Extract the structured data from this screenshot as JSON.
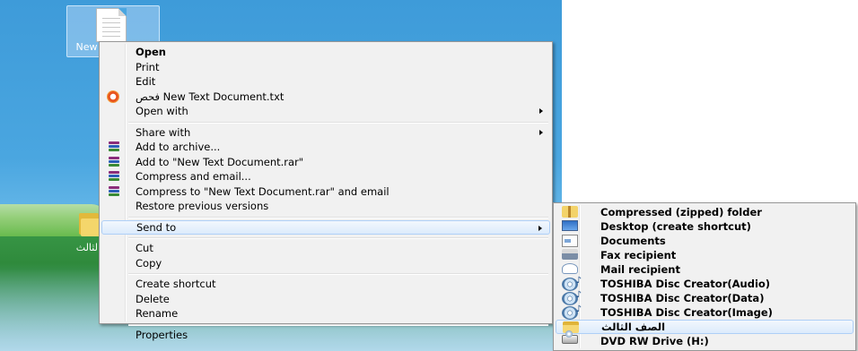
{
  "desktop": {
    "selected_file_caption": "New Text Doc...",
    "folder_caption": "الثالث"
  },
  "context_menu": {
    "items": [
      {
        "label": "Open",
        "bold": true
      },
      {
        "label": "Print"
      },
      {
        "label": "Edit"
      },
      {
        "label": "فحص New Text Document.txt",
        "icon": "antivirus-scan-icon"
      },
      {
        "label": "Open with",
        "submenu": true
      },
      {
        "label": "Share with",
        "submenu": true
      },
      {
        "label": "Add to archive...",
        "icon": "winrar-icon"
      },
      {
        "label": "Add to \"New Text Document.rar\"",
        "icon": "winrar-icon"
      },
      {
        "label": "Compress and email...",
        "icon": "winrar-icon"
      },
      {
        "label": "Compress to \"New Text Document.rar\" and email",
        "icon": "winrar-icon"
      },
      {
        "label": "Restore previous versions"
      },
      {
        "label": "Send to",
        "submenu": true,
        "highlighted": true
      },
      {
        "label": "Cut"
      },
      {
        "label": "Copy"
      },
      {
        "label": "Create shortcut"
      },
      {
        "label": "Delete"
      },
      {
        "label": "Rename"
      },
      {
        "label": "Properties"
      }
    ]
  },
  "sendto_menu": {
    "items": [
      {
        "label": "Compressed (zipped) folder",
        "icon": "zip-folder-icon"
      },
      {
        "label": "Desktop (create shortcut)",
        "icon": "desktop-icon"
      },
      {
        "label": "Documents",
        "icon": "documents-icon"
      },
      {
        "label": "Fax recipient",
        "icon": "fax-icon"
      },
      {
        "label": "Mail recipient",
        "icon": "mail-icon"
      },
      {
        "label": "TOSHIBA Disc Creator(Audio)",
        "icon": "disc-creator-icon"
      },
      {
        "label": "TOSHIBA Disc Creator(Data)",
        "icon": "disc-creator-icon"
      },
      {
        "label": "TOSHIBA Disc Creator(Image)",
        "icon": "disc-creator-icon"
      },
      {
        "label": "الصف الثالث",
        "icon": "folder-icon",
        "highlighted": true
      },
      {
        "label": "DVD RW Drive (H:)",
        "icon": "dvd-drive-icon"
      }
    ]
  },
  "colors": {
    "menu_background": "#f1f1f1",
    "menu_border": "#979797",
    "highlight": "#dcebfc",
    "highlight_border": "#aecff7"
  }
}
